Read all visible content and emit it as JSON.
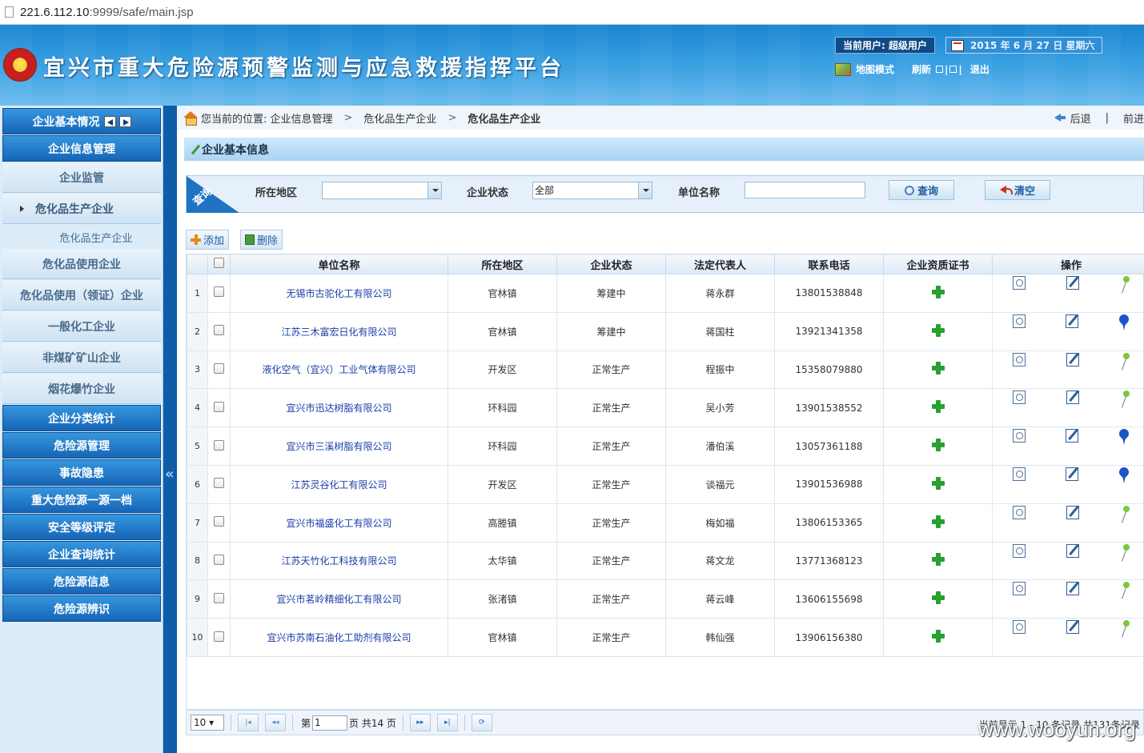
{
  "browser": {
    "url_host": "221.6.112.10",
    "url_rest": ":9999/safe/main.jsp"
  },
  "header": {
    "system_title": "宜兴市重大危险源预警监测与应急救援指挥平台",
    "current_user": "当前用户: 超级用户",
    "date": "2015 年 6 月 27 日 星期六",
    "map_mode": "地图模式",
    "refresh": "刷新",
    "logout": "退出"
  },
  "sidebar": {
    "top": "企业基本情况",
    "info_mgmt": "企业信息管理",
    "sub": [
      "企业监管",
      "危化品生产企业"
    ],
    "leaf": "危化品生产企业",
    "sub2": [
      "危化品使用企业",
      "危化品使用（领证）企业",
      "一般化工企业",
      "非煤矿矿山企业",
      "烟花爆竹企业"
    ],
    "main": [
      "企业分类统计",
      "危险源管理",
      "事故隐患",
      "重大危险源一源一档",
      "安全等级评定",
      "企业查询统计",
      "危险源信息",
      "危险源辨识"
    ]
  },
  "breadcrumb": {
    "prefix": "您当前的位置: 企业信息管理",
    "level2": "危化品生产企业",
    "current": "危化品生产企业",
    "back": "后退",
    "forward": "前进"
  },
  "section_title": "企业基本信息",
  "query": {
    "tag": "查询",
    "region_label": "所在地区",
    "region_value": "",
    "status_label": "企业状态",
    "status_value": "全部",
    "name_label": "单位名称",
    "name_value": "",
    "search_btn": "查询",
    "clear_btn": "清空"
  },
  "toolbar": {
    "add": "添加",
    "delete": "删除"
  },
  "table": {
    "columns": [
      "单位名称",
      "所在地区",
      "企业状态",
      "法定代表人",
      "联系电话",
      "企业资质证书",
      "操作"
    ],
    "rows": [
      {
        "n": "1",
        "name": "无锡市古驼化工有限公司",
        "region": "官林镇",
        "status": "筹建中",
        "rep": "蒋永群",
        "phone": "13801538848",
        "pin": "pin-green-icon"
      },
      {
        "n": "2",
        "name": "江苏三木富宏日化有限公司",
        "region": "官林镇",
        "status": "筹建中",
        "rep": "蒋国柱",
        "phone": "13921341358",
        "pin": "pin-blue-icon"
      },
      {
        "n": "3",
        "name": "液化空气（宜兴）工业气体有限公司",
        "region": "开发区",
        "status": "正常生产",
        "rep": "程振中",
        "phone": "15358079880",
        "pin": "pin-green-icon"
      },
      {
        "n": "4",
        "name": "宜兴市迅达树脂有限公司",
        "region": "环科园",
        "status": "正常生产",
        "rep": "吴小芳",
        "phone": "13901538552",
        "pin": "pin-green-icon"
      },
      {
        "n": "5",
        "name": "宜兴市三溪树脂有限公司",
        "region": "环科园",
        "status": "正常生产",
        "rep": "潘伯溪",
        "phone": "13057361188",
        "pin": "pin-blue-icon"
      },
      {
        "n": "6",
        "name": "江苏灵谷化工有限公司",
        "region": "开发区",
        "status": "正常生产",
        "rep": "谈福元",
        "phone": "13901536988",
        "pin": "pin-blue-icon"
      },
      {
        "n": "7",
        "name": "宜兴市福盛化工有限公司",
        "region": "高塍镇",
        "status": "正常生产",
        "rep": "梅如福",
        "phone": "13806153365",
        "pin": "pin-green-icon"
      },
      {
        "n": "8",
        "name": "江苏天竹化工科技有限公司",
        "region": "太华镇",
        "status": "正常生产",
        "rep": "蒋文龙",
        "phone": "13771368123",
        "pin": "pin-green-icon"
      },
      {
        "n": "9",
        "name": "宜兴市茗岭精细化工有限公司",
        "region": "张渚镇",
        "status": "正常生产",
        "rep": "蒋云峰",
        "phone": "13606155698",
        "pin": "pin-green-icon"
      },
      {
        "n": "10",
        "name": "宜兴市苏南石油化工助剂有限公司",
        "region": "官林镇",
        "status": "正常生产",
        "rep": "韩仙强",
        "phone": "13906156380",
        "pin": "pin-green-icon"
      }
    ]
  },
  "pager": {
    "page_size": "10",
    "page_prefix": "第",
    "page_value": "1",
    "page_suffix": "页 共14 页",
    "status": "当前显示 1 - 10 条记录 共131条记录"
  },
  "watermark": "www.wooyun.org"
}
